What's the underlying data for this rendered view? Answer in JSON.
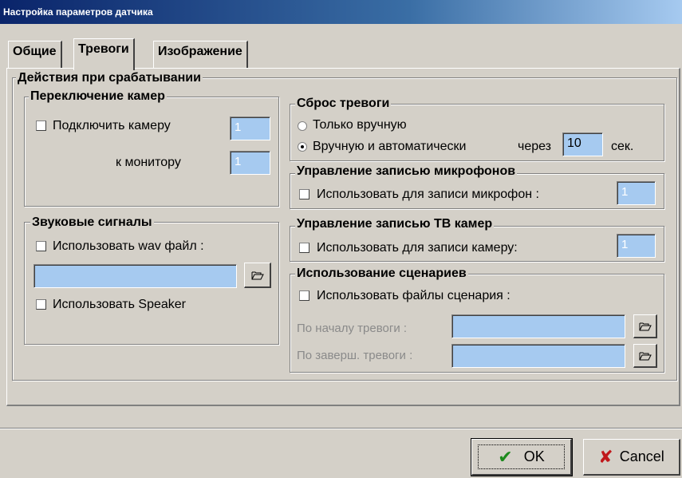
{
  "window": {
    "title": "Настройка параметров датчика"
  },
  "tabs": [
    "Общие",
    "Тревоги",
    "Изображение"
  ],
  "actions_group": {
    "title": "Действия при срабатывании",
    "camera_switch": {
      "title": "Переключение камер",
      "connect_camera_label": "Подключить камеру",
      "camera_value": "1",
      "monitor_label": "к монитору",
      "monitor_value": "1"
    },
    "sounds": {
      "title": "Звуковые сигналы",
      "use_wav_label": "Использовать wav файл :",
      "wav_path": "",
      "use_speaker_label": "Использовать Speaker"
    },
    "alarm_reset": {
      "title": "Сброс тревоги",
      "manual_label": "Только вручную",
      "auto_label": "Вручную и автоматически",
      "after_label": "через",
      "seconds_value": "10",
      "seconds_unit": "сек."
    },
    "mic_recording": {
      "title": "Управление записью микрофонов",
      "use_mic_label": "Использовать для записи микрофон :",
      "mic_value": "1"
    },
    "tv_recording": {
      "title": "Управление записью ТВ камер",
      "use_camera_label": "Использовать для записи камеру:",
      "camera_value": "1"
    },
    "scenarios": {
      "title": "Использование сценариев",
      "use_files_label": "Использовать файлы сценария :",
      "on_start_label": "По началу тревоги :",
      "on_start_path": "",
      "on_end_label": "По заверш. тревоги :",
      "on_end_path": ""
    }
  },
  "buttons": {
    "ok": "OK",
    "cancel": "Cancel"
  }
}
